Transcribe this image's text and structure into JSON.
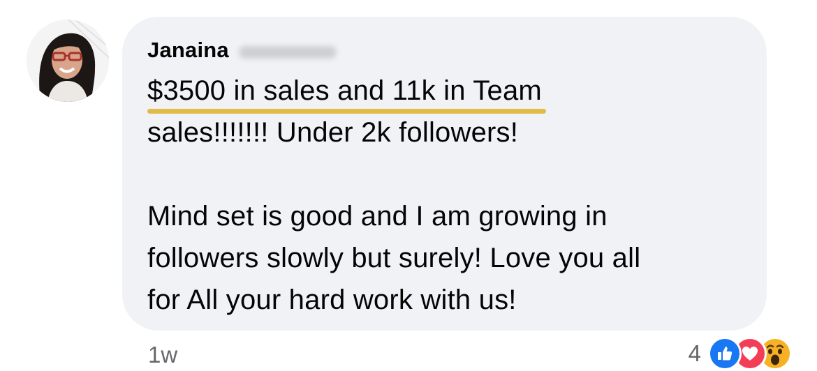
{
  "comment": {
    "author": "Janaina",
    "lines_paragraph1": [
      "$3500 in sales and 11k in Team",
      "sales!!!!!!! Under 2k followers!"
    ],
    "lines_paragraph2": [
      "Mind set is good and I am growing in",
      "followers slowly but surely! Love you all",
      "for All your hard work with us!"
    ],
    "timestamp": "1w",
    "reaction_count": "4",
    "reactions": [
      "like-icon",
      "love-icon",
      "wow-icon"
    ],
    "highlight_color": "#e1bb47",
    "bubble_color": "#f0f2f5"
  }
}
